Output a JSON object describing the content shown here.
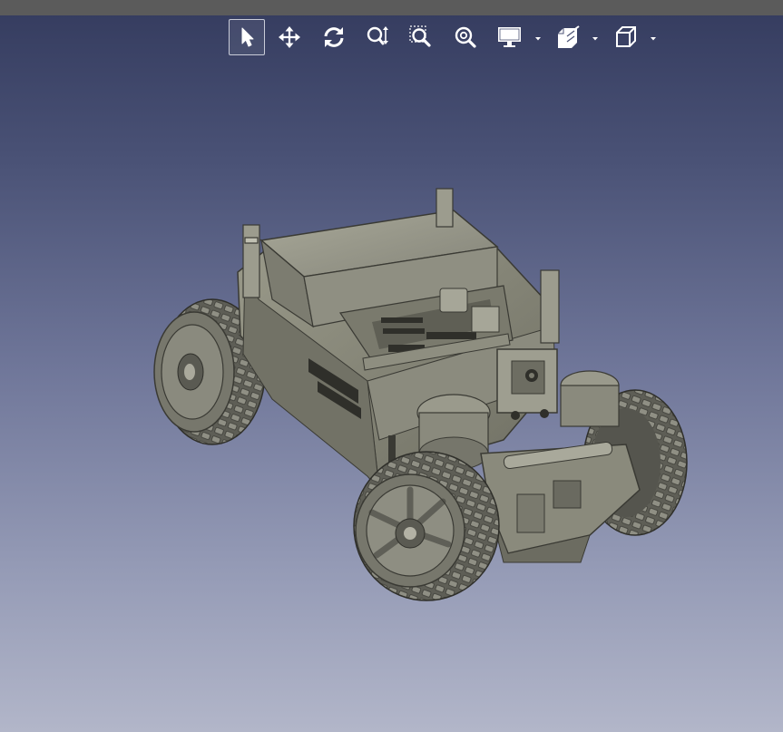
{
  "window": {
    "top_bar_color": "#5b5b5b",
    "background_top": "#343b5e",
    "background_bottom": "#b2b6c9"
  },
  "toolbar": {
    "tools": [
      {
        "name": "select-tool",
        "icon": "arrow-pointer-icon",
        "active": true
      },
      {
        "name": "pan-tool",
        "icon": "move-arrows-icon",
        "active": false
      },
      {
        "name": "rotate-tool",
        "icon": "rotate-icon",
        "active": false
      },
      {
        "name": "zoom-tool",
        "icon": "zoom-updown-icon",
        "active": false
      },
      {
        "name": "zoom-box-tool",
        "icon": "zoom-box-icon",
        "active": false
      },
      {
        "name": "zoom-fit-tool",
        "icon": "zoom-fit-icon",
        "active": false
      },
      {
        "name": "display-mode-menu",
        "icon": "monitor-icon",
        "has_dropdown": true
      },
      {
        "name": "clipping-menu",
        "icon": "clip-plane-icon",
        "has_dropdown": true
      },
      {
        "name": "view-cube-menu",
        "icon": "cube-icon",
        "has_dropdown": true
      }
    ]
  },
  "model": {
    "subject": "robot-car-3d-model",
    "body_color": "#8a8a7a",
    "tire_color": "#6f6f66"
  }
}
